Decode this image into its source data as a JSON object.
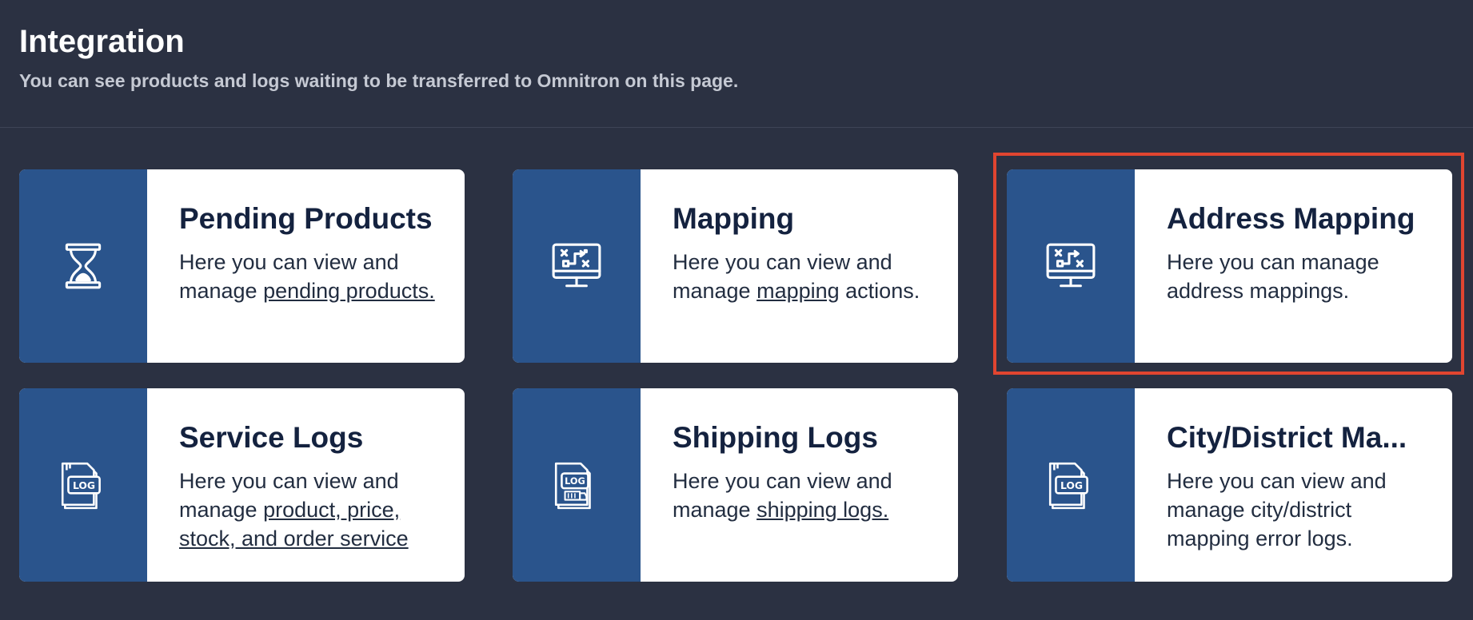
{
  "header": {
    "title": "Integration",
    "subtitle": "You can see products and logs waiting to be transferred to Omnitron on this page."
  },
  "cards": [
    {
      "icon": "hourglass-icon",
      "title": "Pending Products",
      "desc_prefix": "Here you can view and manage ",
      "desc_link": "pending products.",
      "desc_suffix": ""
    },
    {
      "icon": "monitor-workflow-icon",
      "title": "Mapping",
      "desc_prefix": "Here you can view and manage ",
      "desc_link": "mapping",
      "desc_suffix": " actions."
    },
    {
      "icon": "monitor-workflow-icon",
      "title": "Address Mapping",
      "desc_prefix": "Here you can manage address mappings.",
      "desc_link": "",
      "desc_suffix": ""
    },
    {
      "icon": "log-file-icon",
      "title": "Service Logs",
      "desc_prefix": "Here you can view and manage ",
      "desc_link": "product, price, stock, and order service",
      "desc_suffix": ""
    },
    {
      "icon": "log-file-shipping-icon",
      "title": "Shipping Logs",
      "desc_prefix": "Here you can view and manage ",
      "desc_link": "shipping logs.",
      "desc_suffix": ""
    },
    {
      "icon": "log-file-icon",
      "title": "City/District Ma...",
      "desc_prefix": "Here you can view and manage city/district mapping error logs.",
      "desc_link": "",
      "desc_suffix": ""
    }
  ],
  "colors": {
    "background": "#2b3142",
    "card_icon_panel": "#2a548c",
    "highlight": "#e04530",
    "title_text": "#14223f"
  }
}
